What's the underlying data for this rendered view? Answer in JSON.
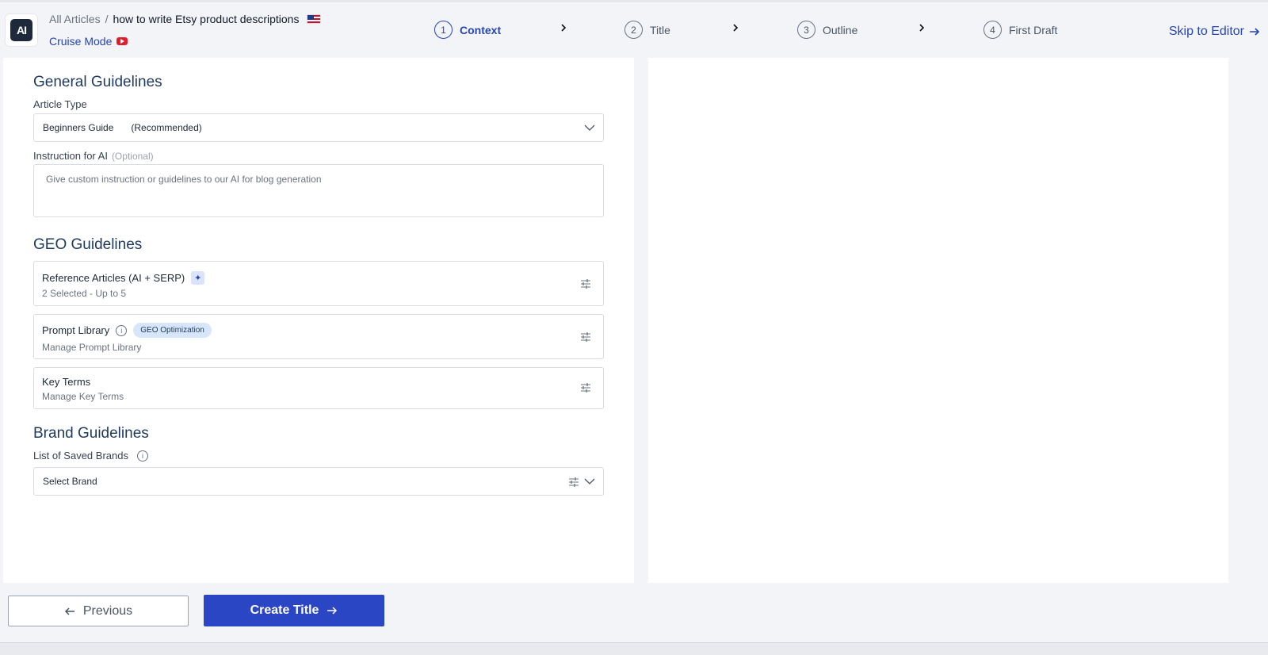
{
  "header": {
    "logo_text": "AI",
    "breadcrumb": {
      "root": "All Articles",
      "separator": "/",
      "current": "how to write Etsy product descriptions"
    },
    "cruise_mode": "Cruise Mode",
    "steps": [
      {
        "num": "1",
        "label": "Context",
        "active": true
      },
      {
        "num": "2",
        "label": "Title"
      },
      {
        "num": "3",
        "label": "Outline"
      },
      {
        "num": "4",
        "label": "First Draft"
      }
    ],
    "skip_label": "Skip to Editor"
  },
  "general": {
    "title": "General Guidelines",
    "article_type_label": "Article Type",
    "article_type_value": "Beginners Guide",
    "article_type_tag": "(Recommended)",
    "instruction_label": "Instruction for AI",
    "instruction_optional": "(Optional)",
    "instruction_placeholder": "Give custom instruction or guidelines to our AI for blog generation"
  },
  "geo": {
    "title": "GEO Guidelines",
    "reference": {
      "title": "Reference Articles (AI + SERP)",
      "sub": "2 Selected - Up to 5"
    },
    "prompt": {
      "title": "Prompt Library",
      "badge": "GEO Optimization",
      "sub": "Manage Prompt Library"
    },
    "keyterms": {
      "title": "Key Terms",
      "sub": "Manage Key Terms"
    }
  },
  "brand": {
    "title": "Brand Guidelines",
    "list_label": "List of Saved Brands",
    "select_placeholder": "Select Brand"
  },
  "footer": {
    "prev_label": "Previous",
    "next_label": "Create Title"
  },
  "colors": {
    "accent": "#2545b8",
    "primary_button": "#2b46c5"
  }
}
